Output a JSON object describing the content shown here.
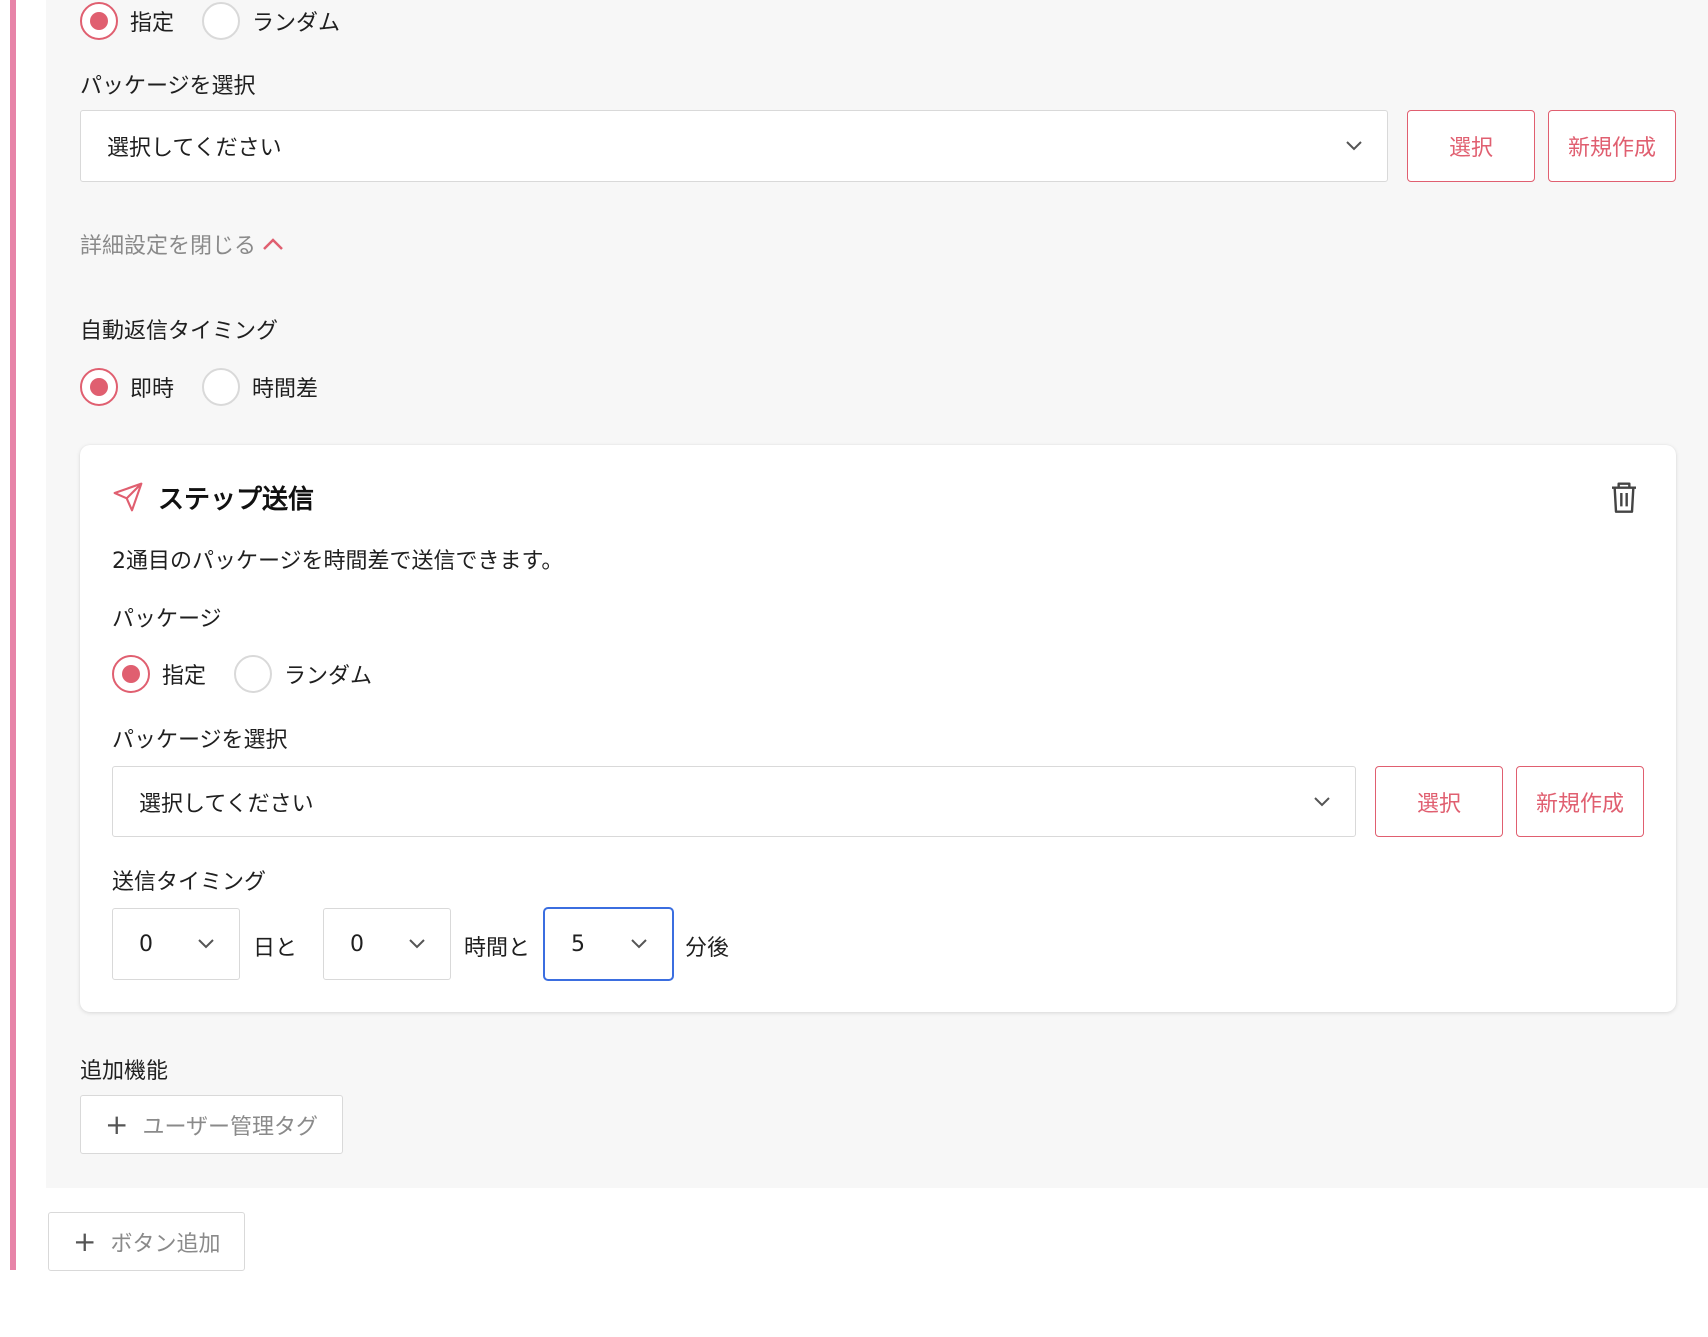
{
  "top": {
    "package_mode": {
      "options": [
        "指定",
        "ランダム"
      ],
      "selected": "指定"
    },
    "package_select_label": "パッケージを選択",
    "package_select_value": "選択してください",
    "select_button": "選択",
    "new_button": "新規作成",
    "details_toggle": "詳細設定を閉じる",
    "timing_label": "自動返信タイミング",
    "timing_mode": {
      "options": [
        "即時",
        "時間差"
      ],
      "selected": "即時"
    }
  },
  "step": {
    "title": "ステップ送信",
    "icon": "send-icon",
    "delete_icon": "trash-icon",
    "description": "2通目のパッケージを時間差で送信できます。",
    "package_label": "パッケージ",
    "package_mode": {
      "options": [
        "指定",
        "ランダム"
      ],
      "selected": "指定"
    },
    "package_select_label": "パッケージを選択",
    "package_select_value": "選択してください",
    "select_button": "選択",
    "new_button": "新規作成",
    "timing_label": "送信タイミング",
    "days_value": "0",
    "days_unit": "日と",
    "hours_value": "0",
    "hours_unit": "時間と",
    "minutes_value": "5",
    "minutes_unit": "分後"
  },
  "extras": {
    "label": "追加機能",
    "user_tag_button": "ユーザー管理タグ"
  },
  "add_button": "ボタン追加",
  "colors": {
    "accent": "#e05f70",
    "left_bar": "#e784a8",
    "focus": "#3b6ee0"
  }
}
